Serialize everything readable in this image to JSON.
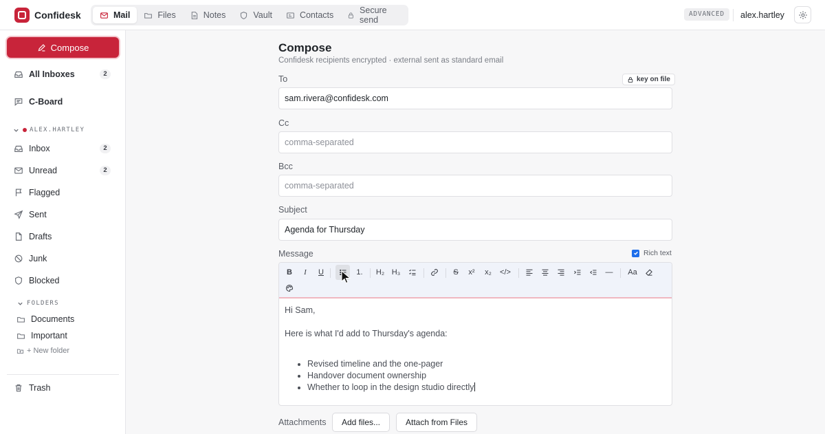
{
  "app": {
    "name": "Confidesk",
    "brand_color": "#c8243a"
  },
  "nav_tabs": [
    {
      "label": "Mail",
      "icon": "mail-icon",
      "active": true
    },
    {
      "label": "Files",
      "icon": "folder-icon"
    },
    {
      "label": "Notes",
      "icon": "note-icon"
    },
    {
      "label": "Vault",
      "icon": "shield-icon"
    },
    {
      "label": "Contacts",
      "icon": "contact-card-icon"
    },
    {
      "label": "Secure send",
      "icon": "lock-icon"
    }
  ],
  "header": {
    "mode_badge": "ADVANCED",
    "username": "alex.hartley"
  },
  "sidebar": {
    "compose_label": "Compose",
    "all_inboxes": {
      "label": "All Inboxes",
      "count": "2"
    },
    "cboard": {
      "label": "C-Board"
    },
    "account_label": "ALEX.HARTLEY",
    "items": [
      {
        "label": "Inbox",
        "count": "2",
        "icon": "inbox-icon"
      },
      {
        "label": "Unread",
        "count": "2",
        "icon": "envelope-icon"
      },
      {
        "label": "Flagged",
        "icon": "flag-icon"
      },
      {
        "label": "Sent",
        "icon": "send-icon"
      },
      {
        "label": "Drafts",
        "icon": "file-icon"
      },
      {
        "label": "Junk",
        "icon": "ban-icon"
      },
      {
        "label": "Blocked",
        "icon": "shield-icon"
      }
    ],
    "folders_label": "FOLDERS",
    "folders": [
      {
        "label": "Documents"
      },
      {
        "label": "Important"
      }
    ],
    "new_folder_label": "+ New folder",
    "trash_label": "Trash"
  },
  "compose": {
    "title": "Compose",
    "subtitle": "Confidesk recipients encrypted · external sent as standard email",
    "to_label": "To",
    "to_value": "sam.rivera@confidesk.com",
    "key_badge": "key on file",
    "cc_label": "Cc",
    "cc_placeholder": "comma-separated",
    "bcc_label": "Bcc",
    "bcc_placeholder": "comma-separated",
    "subject_label": "Subject",
    "subject_value": "Agenda for Thursday",
    "message_label": "Message",
    "rich_text_label": "Rich text",
    "rich_text_enabled": true,
    "toolbar": {
      "bold": "B",
      "italic": "I",
      "underline": "U",
      "ordered_list": "1.",
      "h2": "H₂",
      "h3": "H₃",
      "strike": "S",
      "superscript": "x²",
      "subscript": "x₂",
      "code": "</>",
      "rule": "—",
      "font_size": "Aa"
    },
    "body": {
      "greeting": "Hi Sam,",
      "intro": "Here is what I'd add to Thursday's agenda:",
      "bullets": [
        "Revised timeline and the one-pager",
        "Handover document ownership",
        "Whether to loop in the design studio directly"
      ]
    },
    "attachments_label": "Attachments",
    "add_files_label": "Add files...",
    "attach_from_files_label": "Attach from Files"
  }
}
